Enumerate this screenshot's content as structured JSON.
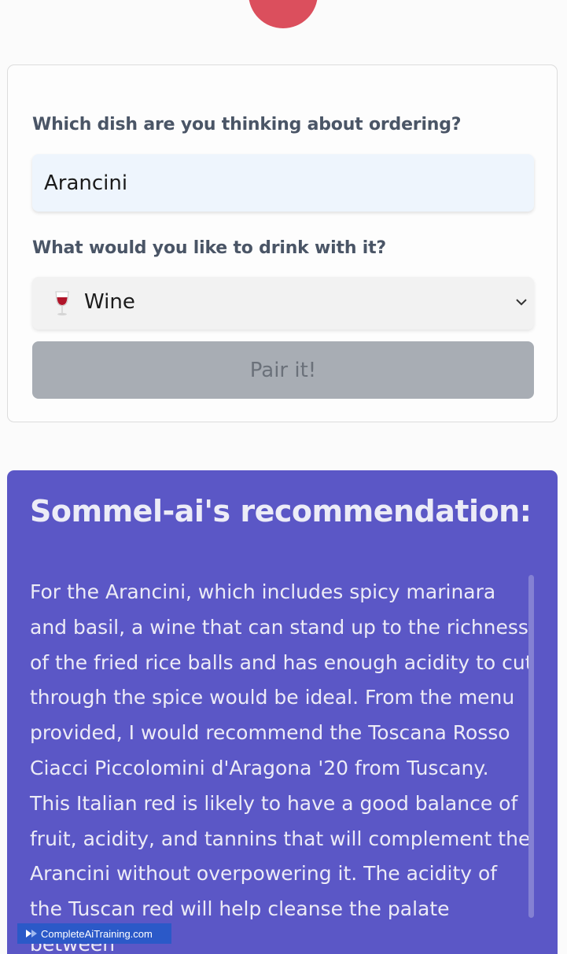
{
  "form": {
    "dish_question": "Which dish are you thinking about ordering?",
    "dish_value": "Arancini",
    "drink_question": "What would you like to drink with it?",
    "drink_selected": "Wine",
    "drink_icon": "wine-glass-icon",
    "pair_button_label": "Pair it!"
  },
  "recommendation": {
    "title": "Sommel-ai's recommendation:",
    "text": "For the Arancini, which includes spicy marinara and basil, a wine that can stand up to the richness of the fried rice balls and has enough acidity to cut through the spice would be ideal. From the menu provided, I would recommend the Toscana Rosso Ciacci Piccolomini d'Aragona '20 from Tuscany. This Italian red is likely to have a good balance of fruit, acidity, and tannins that will complement the Arancini without overpowering it. The acidity of the Tuscan red will help cleanse the palate between"
  },
  "watermark": {
    "text": "CompleteAiTraining.com"
  },
  "colors": {
    "logo": "#db4f5d",
    "recommendation_bg": "#5b57c6",
    "button_disabled": "#a8adb4"
  }
}
